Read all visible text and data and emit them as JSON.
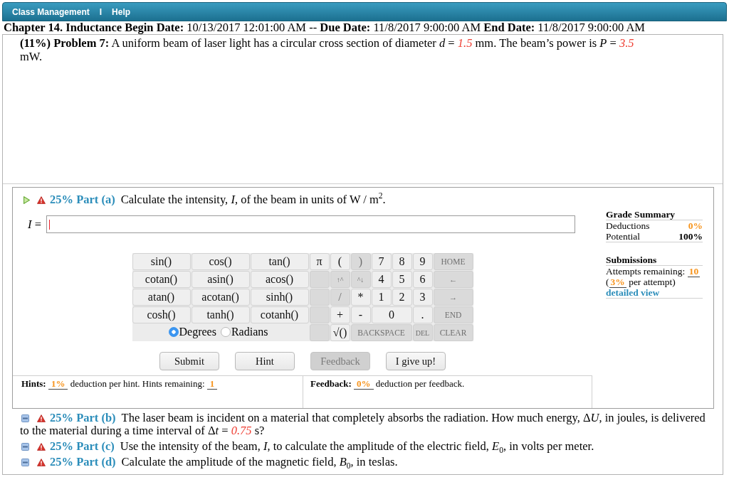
{
  "menu": {
    "items": [
      {
        "label": "Class Management"
      },
      {
        "label": "Help"
      }
    ],
    "separator": "I"
  },
  "deadline": "**Chapter 14. Inductance Begin Date:** 10/13/2017 12:01:00 AM -- **Due Date:** 11/8/2017 9:00:00 AM **End Date:** 11/8/2017 9:00:00 AM",
  "problem": [
    {
      "kind": "text",
      "text": "**(11%) Problem 7:** A uniform beam of laser light has a circular cross section of diameter *d* = "
    },
    {
      "kind": "given",
      "text": "1.5"
    },
    {
      "kind": "text",
      "text": " mm. The beam’s power is *P* = "
    },
    {
      "kind": "given",
      "text": "3.5"
    },
    {
      "kind": "text",
      "text": " mW."
    }
  ],
  "parts": [
    {
      "title": "25% Part (a)",
      "expanded": true,
      "warning": true,
      "prompt": [
        {
          "kind": "text",
          "text": "Calculate the intensity, *I*, of the beam in units of W / m$^{2}$."
        }
      ],
      "answer": {
        "label": "*I* =",
        "focused": true
      },
      "keypad": {
        "functions": [
          {
            "label": "sin()"
          },
          {
            "label": "cos()"
          },
          {
            "label": "tan()"
          },
          {
            "label": "cotan()"
          },
          {
            "label": "asin()"
          },
          {
            "label": "acos()"
          },
          {
            "label": "atan()"
          },
          {
            "label": "acotan()"
          },
          {
            "label": "sinh()"
          },
          {
            "label": "cosh()"
          },
          {
            "label": "tanh()"
          },
          {
            "label": "cotanh()"
          }
        ],
        "angle_units": [
          {
            "label": "Degrees",
            "selected": true
          },
          {
            "label": "Radians",
            "selected": false
          }
        ],
        "keys": [
          {
            "kind": "symbol",
            "label": "π",
            "disabled": false
          },
          {
            "kind": "symbol",
            "label": "(",
            "disabled": false
          },
          {
            "kind": "symbol",
            "label": ")",
            "disabled": true
          },
          {
            "kind": "symbol",
            "label": "7",
            "disabled": false
          },
          {
            "kind": "symbol",
            "label": "8",
            "disabled": false
          },
          {
            "kind": "symbol",
            "label": "9",
            "disabled": false
          },
          {
            "kind": "command",
            "label": "HOME",
            "disabled": true
          },
          {
            "kind": "blank",
            "disabled": true
          },
          {
            "kind": "command",
            "label": "↑^",
            "disabled": true
          },
          {
            "kind": "command",
            "label": "^↓",
            "disabled": true
          },
          {
            "kind": "symbol",
            "label": "4",
            "disabled": false
          },
          {
            "kind": "symbol",
            "label": "5",
            "disabled": false
          },
          {
            "kind": "symbol",
            "label": "6",
            "disabled": false
          },
          {
            "kind": "command",
            "label": "←",
            "disabled": true
          },
          {
            "kind": "blank",
            "disabled": true
          },
          {
            "kind": "symbol",
            "label": "/",
            "disabled": true
          },
          {
            "kind": "symbol",
            "label": "*",
            "disabled": false
          },
          {
            "kind": "symbol",
            "label": "1",
            "disabled": false
          },
          {
            "kind": "symbol",
            "label": "2",
            "disabled": false
          },
          {
            "kind": "symbol",
            "label": "3",
            "disabled": false
          },
          {
            "kind": "command",
            "label": "→",
            "disabled": true
          },
          {
            "kind": "blank",
            "disabled": true
          },
          {
            "kind": "symbol",
            "label": "+",
            "disabled": false
          },
          {
            "kind": "symbol",
            "label": "-",
            "disabled": false
          },
          {
            "kind": "symbol",
            "label": "0",
            "disabled": false
          },
          {
            "kind": "symbol",
            "label": ".",
            "disabled": false
          },
          {
            "kind": "command",
            "label": "END",
            "disabled": true
          },
          {
            "kind": "blank",
            "disabled": true
          },
          {
            "kind": "symbol",
            "label": "√()",
            "disabled": false
          },
          {
            "kind": "command",
            "label": "BACKSPACE",
            "disabled": true
          },
          {
            "kind": "command",
            "label": "DEL",
            "disabled": true
          },
          {
            "kind": "command",
            "label": "CLEAR",
            "disabled": true
          }
        ]
      },
      "buttons": [
        {
          "label": "Submit",
          "disabled": false
        },
        {
          "label": "Hint",
          "disabled": false
        },
        {
          "label": "Feedback",
          "disabled": true
        },
        {
          "label": "I give up!",
          "disabled": false
        }
      ],
      "hints": [
        {
          "kind": "text",
          "text": "**Hints:** "
        },
        {
          "kind": "value",
          "text": "1%"
        },
        {
          "kind": "text",
          "text": " deduction per hint. Hints remaining: "
        },
        {
          "kind": "value",
          "text": "1"
        }
      ],
      "feedback": [
        {
          "kind": "text",
          "text": "**Feedback:** "
        },
        {
          "kind": "value",
          "text": "0%"
        },
        {
          "kind": "text",
          "text": " deduction per feedback."
        }
      ],
      "grade_summary": {
        "title": "Grade Summary",
        "rows": [
          {
            "label": "Deductions",
            "value": "0%",
            "kind": "deduction"
          },
          {
            "label": "Potential",
            "value": "100%",
            "kind": "potential"
          }
        ]
      },
      "submissions": {
        "title": "Submissions",
        "attempts": [
          {
            "kind": "text",
            "text": "Attempts remaining: "
          },
          {
            "kind": "value",
            "text": "10"
          },
          {
            "kind": "text",
            "text": " ("
          },
          {
            "kind": "value",
            "text": "3%"
          },
          {
            "kind": "text",
            "text": " per attempt)"
          }
        ],
        "link": "detailed view"
      }
    },
    {
      "title": "25% Part (b)",
      "expanded": false,
      "warning": true,
      "prompt": [
        {
          "kind": "text",
          "text": "The laser beam is incident on a material that completely absorbs the radiation. How much energy, Δ"
        },
        {
          "kind": "text",
          "text": "*U*, in joules, is delivered to the material during a time interval of Δ"
        },
        {
          "kind": "text",
          "text": "*t* = "
        },
        {
          "kind": "given",
          "text": "0.75"
        },
        {
          "kind": "text",
          "text": " s?"
        }
      ]
    },
    {
      "title": "25% Part (c)",
      "expanded": false,
      "warning": true,
      "prompt": [
        {
          "kind": "text",
          "text": "Use the intensity of the beam, *I*, to calculate the amplitude of the electric field, *E*$_{0}$, in volts per meter."
        }
      ]
    },
    {
      "title": "25% Part (d)",
      "expanded": false,
      "warning": true,
      "prompt": [
        {
          "kind": "text",
          "text": "Calculate the amplitude of the magnetic field, *B*$_{0}$, in teslas."
        }
      ]
    }
  ]
}
